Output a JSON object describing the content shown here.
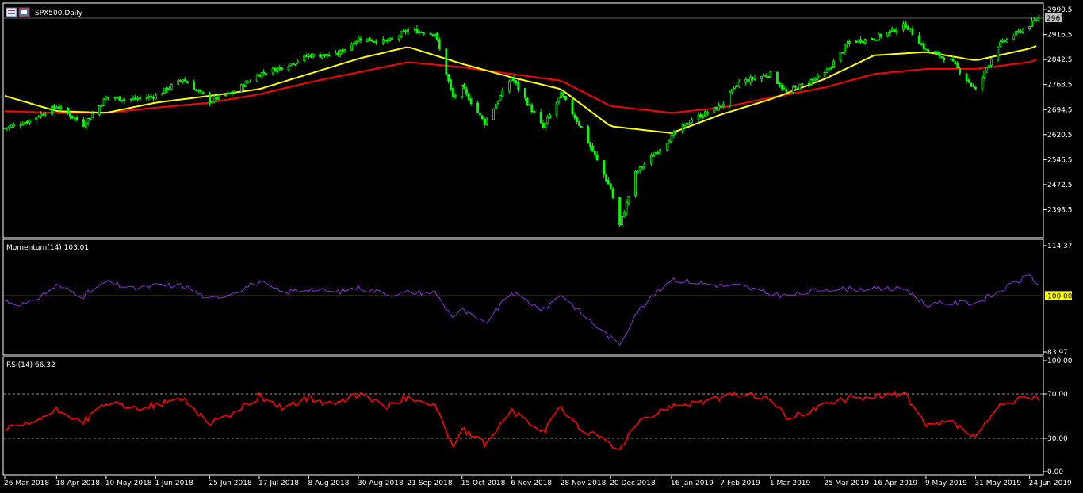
{
  "window": {
    "symbol_title": "SPX500,Daily"
  },
  "colors": {
    "background": "#000000",
    "frame": "#ffffff",
    "bull": "#00ff00",
    "bear": "#00ff00",
    "ma_fast": "#ffff00",
    "ma_slow": "#ff0000",
    "momentum": "#8a2be2",
    "momentum_ref": "#ffff00",
    "rsi": "#ff0000",
    "level": "#c0c0c0",
    "current_price_bg": "#c0c0c0",
    "highlight_bg": "#ffff00"
  },
  "chart_data": [
    {
      "type": "candlestick",
      "title": "SPX500,Daily",
      "ylim": [
        2324.5,
        3000
      ],
      "yticks": [
        "2990.5",
        "2916.5",
        "2842.5",
        "2768.5",
        "2694.5",
        "2620.5",
        "2546.5",
        "2472.5",
        "2398.5"
      ],
      "current_price": "2967.3",
      "x_dates": [
        "26 Mar 2018",
        "18 Apr 2018",
        "10 May 2018",
        "1 Jun 2018",
        "25 Jun 2018",
        "17 Jul 2018",
        "8 Aug 2018",
        "30 Aug 2018",
        "21 Sep 2018",
        "15 Oct 2018",
        "6 Nov 2018",
        "28 Nov 2018",
        "20 Dec 2018",
        "16 Jan 2019",
        "7 Feb 2019",
        "1 Mar 2019",
        "25 Mar 2019",
        "16 Apr 2019",
        "9 May 2019",
        "31 May 2019",
        "24 Jun 2019"
      ],
      "close_path": [
        [
          "26 Mar 2018",
          2640
        ],
        [
          "5 Apr 2018",
          2660
        ],
        [
          "18 Apr 2018",
          2705
        ],
        [
          "30 Apr 2018",
          2650
        ],
        [
          "10 May 2018",
          2730
        ],
        [
          "22 May 2018",
          2725
        ],
        [
          "1 Jun 2018",
          2735
        ],
        [
          "13 Jun 2018",
          2785
        ],
        [
          "25 Jun 2018",
          2720
        ],
        [
          "5 Jul 2018",
          2745
        ],
        [
          "17 Jul 2018",
          2800
        ],
        [
          "27 Jul 2018",
          2820
        ],
        [
          "8 Aug 2018",
          2855
        ],
        [
          "20 Aug 2018",
          2855
        ],
        [
          "30 Aug 2018",
          2905
        ],
        [
          "12 Sep 2018",
          2895
        ],
        [
          "21 Sep 2018",
          2930
        ],
        [
          "3 Oct 2018",
          2920
        ],
        [
          "11 Oct 2018",
          2730
        ],
        [
          "15 Oct 2018",
          2760
        ],
        [
          "25 Oct 2018",
          2655
        ],
        [
          "6 Nov 2018",
          2790
        ],
        [
          "20 Nov 2018",
          2640
        ],
        [
          "28 Nov 2018",
          2740
        ],
        [
          "7 Dec 2018",
          2640
        ],
        [
          "20 Dec 2018",
          2460
        ],
        [
          "24 Dec 2018",
          2351
        ],
        [
          "31 Dec 2018",
          2506
        ],
        [
          "16 Jan 2019",
          2615
        ],
        [
          "25 Jan 2019",
          2665
        ],
        [
          "7 Feb 2019",
          2705
        ],
        [
          "15 Feb 2019",
          2775
        ],
        [
          "1 Mar 2019",
          2800
        ],
        [
          "8 Mar 2019",
          2745
        ],
        [
          "25 Mar 2019",
          2800
        ],
        [
          "5 Apr 2019",
          2895
        ],
        [
          "16 Apr 2019",
          2905
        ],
        [
          "30 Apr 2019",
          2945
        ],
        [
          "9 May 2019",
          2870
        ],
        [
          "20 May 2019",
          2840
        ],
        [
          "31 May 2019",
          2752
        ],
        [
          "10 Jun 2019",
          2885
        ],
        [
          "24 Jun 2019",
          2945
        ],
        [
          "28 Jun 2019",
          2967
        ]
      ],
      "ma_fast_path": [
        [
          "26 Mar 2018",
          2735
        ],
        [
          "18 Apr 2018",
          2690
        ],
        [
          "10 May 2018",
          2685
        ],
        [
          "1 Jun 2018",
          2715
        ],
        [
          "25 Jun 2018",
          2735
        ],
        [
          "17 Jul 2018",
          2755
        ],
        [
          "8 Aug 2018",
          2800
        ],
        [
          "30 Aug 2018",
          2845
        ],
        [
          "21 Sep 2018",
          2880
        ],
        [
          "15 Oct 2018",
          2830
        ],
        [
          "6 Nov 2018",
          2790
        ],
        [
          "28 Nov 2018",
          2755
        ],
        [
          "20 Dec 2018",
          2645
        ],
        [
          "16 Jan 2019",
          2625
        ],
        [
          "7 Feb 2019",
          2680
        ],
        [
          "1 Mar 2019",
          2725
        ],
        [
          "25 Mar 2019",
          2785
        ],
        [
          "16 Apr 2019",
          2855
        ],
        [
          "9 May 2019",
          2865
        ],
        [
          "31 May 2019",
          2840
        ],
        [
          "24 Jun 2019",
          2875
        ],
        [
          "28 Jun 2019",
          2885
        ]
      ],
      "ma_slow_path": [
        [
          "26 Mar 2018",
          2690
        ],
        [
          "18 Apr 2018",
          2685
        ],
        [
          "10 May 2018",
          2685
        ],
        [
          "1 Jun 2018",
          2700
        ],
        [
          "25 Jun 2018",
          2715
        ],
        [
          "17 Jul 2018",
          2740
        ],
        [
          "8 Aug 2018",
          2775
        ],
        [
          "30 Aug 2018",
          2805
        ],
        [
          "21 Sep 2018",
          2835
        ],
        [
          "15 Oct 2018",
          2820
        ],
        [
          "6 Nov 2018",
          2800
        ],
        [
          "28 Nov 2018",
          2780
        ],
        [
          "20 Dec 2018",
          2705
        ],
        [
          "16 Jan 2019",
          2685
        ],
        [
          "7 Feb 2019",
          2700
        ],
        [
          "1 Mar 2019",
          2730
        ],
        [
          "25 Mar 2019",
          2760
        ],
        [
          "16 Apr 2019",
          2800
        ],
        [
          "9 May 2019",
          2815
        ],
        [
          "31 May 2019",
          2815
        ],
        [
          "24 Jun 2019",
          2835
        ],
        [
          "28 Jun 2019",
          2845
        ]
      ]
    },
    {
      "type": "line",
      "title": "Momentum(14) 103.01",
      "ylim": [
        83.97,
        114.37
      ],
      "yticks": [
        "114.37",
        "83.97"
      ],
      "reference_level": "100.00",
      "series": [
        {
          "name": "Momentum(14)",
          "points": [
            [
              "26 Mar 2018",
              98.5
            ],
            [
              "5 Apr 2018",
              97.5
            ],
            [
              "18 Apr 2018",
              103
            ],
            [
              "30 Apr 2018",
              100
            ],
            [
              "10 May 2018",
              104
            ],
            [
              "22 May 2018",
              102
            ],
            [
              "1 Jun 2018",
              103
            ],
            [
              "13 Jun 2018",
              103
            ],
            [
              "25 Jun 2018",
              99
            ],
            [
              "5 Jul 2018",
              101
            ],
            [
              "17 Jul 2018",
              104
            ],
            [
              "27 Jul 2018",
              101
            ],
            [
              "8 Aug 2018",
              102
            ],
            [
              "20 Aug 2018",
              101
            ],
            [
              "30 Aug 2018",
              102.5
            ],
            [
              "12 Sep 2018",
              100.5
            ],
            [
              "21 Sep 2018",
              101
            ],
            [
              "3 Oct 2018",
              101
            ],
            [
              "11 Oct 2018",
              94
            ],
            [
              "15 Oct 2018",
              96
            ],
            [
              "25 Oct 2018",
              92
            ],
            [
              "6 Nov 2018",
              101
            ],
            [
              "20 Nov 2018",
              96
            ],
            [
              "28 Nov 2018",
              100.5
            ],
            [
              "7 Dec 2018",
              95
            ],
            [
              "20 Dec 2018",
              88
            ],
            [
              "24 Dec 2018",
              86
            ],
            [
              "31 Dec 2018",
              95
            ],
            [
              "16 Jan 2019",
              105
            ],
            [
              "25 Jan 2019",
              104
            ],
            [
              "7 Feb 2019",
              103
            ],
            [
              "15 Feb 2019",
              103
            ],
            [
              "1 Mar 2019",
              100.5
            ],
            [
              "8 Mar 2019",
              100
            ],
            [
              "25 Mar 2019",
              102
            ],
            [
              "5 Apr 2019",
              102
            ],
            [
              "16 Apr 2019",
              102
            ],
            [
              "30 Apr 2019",
              102
            ],
            [
              "9 May 2019",
              97.5
            ],
            [
              "20 May 2019",
              98
            ],
            [
              "31 May 2019",
              98
            ],
            [
              "10 Jun 2019",
              101
            ],
            [
              "24 Jun 2019",
              106
            ],
            [
              "28 Jun 2019",
              103.01
            ]
          ]
        }
      ]
    },
    {
      "type": "line",
      "title": "RSI(14) 66.32",
      "ylim": [
        0,
        100
      ],
      "yticks": [
        "100.00",
        "70.00",
        "30.00",
        "0.00"
      ],
      "levels": [
        70,
        30
      ],
      "series": [
        {
          "name": "RSI(14)",
          "points": [
            [
              "26 Mar 2018",
              38
            ],
            [
              "5 Apr 2018",
              42
            ],
            [
              "18 Apr 2018",
              55
            ],
            [
              "30 Apr 2018",
              45
            ],
            [
              "10 May 2018",
              62
            ],
            [
              "22 May 2018",
              57
            ],
            [
              "1 Jun 2018",
              60
            ],
            [
              "13 Jun 2018",
              66
            ],
            [
              "25 Jun 2018",
              44
            ],
            [
              "5 Jul 2018",
              52
            ],
            [
              "17 Jul 2018",
              68
            ],
            [
              "27 Jul 2018",
              58
            ],
            [
              "8 Aug 2018",
              66
            ],
            [
              "20 Aug 2018",
              60
            ],
            [
              "30 Aug 2018",
              70
            ],
            [
              "12 Sep 2018",
              58
            ],
            [
              "21 Sep 2018",
              68
            ],
            [
              "3 Oct 2018",
              60
            ],
            [
              "11 Oct 2018",
              22
            ],
            [
              "15 Oct 2018",
              38
            ],
            [
              "25 Oct 2018",
              25
            ],
            [
              "6 Nov 2018",
              55
            ],
            [
              "20 Nov 2018",
              35
            ],
            [
              "28 Nov 2018",
              58
            ],
            [
              "7 Dec 2018",
              38
            ],
            [
              "20 Dec 2018",
              26
            ],
            [
              "24 Dec 2018",
              19
            ],
            [
              "31 Dec 2018",
              42
            ],
            [
              "16 Jan 2019",
              60
            ],
            [
              "25 Jan 2019",
              62
            ],
            [
              "7 Feb 2019",
              66
            ],
            [
              "15 Feb 2019",
              70
            ],
            [
              "1 Mar 2019",
              66
            ],
            [
              "8 Mar 2019",
              48
            ],
            [
              "25 Mar 2019",
              60
            ],
            [
              "5 Apr 2019",
              66
            ],
            [
              "16 Apr 2019",
              68
            ],
            [
              "30 Apr 2019",
              70
            ],
            [
              "9 May 2019",
              40
            ],
            [
              "20 May 2019",
              45
            ],
            [
              "31 May 2019",
              30
            ],
            [
              "10 Jun 2019",
              58
            ],
            [
              "24 Jun 2019",
              68
            ],
            [
              "28 Jun 2019",
              66.32
            ]
          ]
        }
      ]
    }
  ]
}
